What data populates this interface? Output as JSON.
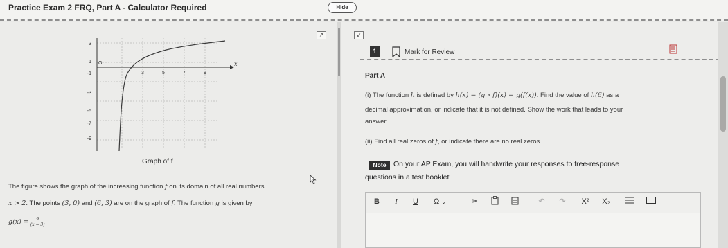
{
  "header": {
    "title": "Practice Exam 2 FRQ, Part A - Calculator Required",
    "hide_label": "Hide"
  },
  "graph": {
    "caption": "Graph of f",
    "y_ticks": [
      "3",
      "1",
      "-1",
      "-3",
      "-5",
      "-7",
      "-9"
    ],
    "x_ticks": [
      "3",
      "5",
      "7",
      "9"
    ],
    "origin_label": "O",
    "x_axis_label": "x"
  },
  "stimulus": {
    "line1": "The figure shows the graph of the increasing function",
    "line1_f": "f",
    "line1_end": "on its domain of all real numbers",
    "line2_x": "x > 2",
    "line2_a": ". The points",
    "point1": "(3, 0)",
    "line2_and": "and",
    "point2": "(6, 3)",
    "line2_b": "are on the graph of",
    "line2_f": "f",
    "line2_c": ". The function",
    "line2_g": "g",
    "line2_d": "is given by",
    "g_def": "g(x) = ",
    "g_num": "9",
    "g_den": "(x − 3)"
  },
  "question": {
    "number": "1",
    "mark_review": "Mark for Review",
    "part": "Part A",
    "i_a": "(i) The function",
    "i_h": "h",
    "i_b": "is defined by",
    "i_def": "h(x) = (g ∘ f)(x) = g(f(x))",
    "i_c": ". Find the value of",
    "i_h6": "h(6)",
    "i_d": "as a",
    "i_line2": "decimal approximation, or indicate that it is not defined. Show the work that leads to your",
    "i_line3": "answer.",
    "ii_a": "(ii) Find all real zeros of",
    "ii_f": "f",
    "ii_b": ", or indicate there are no real zeros.",
    "note_badge": "Note",
    "note_line1": "On your AP Exam, you will handwrite your responses to free-response",
    "note_line2": "questions in a test booklet"
  },
  "toolbar": {
    "bold": "B",
    "italic": "I",
    "underline": "U",
    "omega": "Ω",
    "superscript": "X²",
    "subscript": "X₂"
  },
  "colors": {
    "note_badge": "#2f2f2f",
    "question_number": "#333333",
    "graph_curve": "#3a3a3a",
    "grid": "#9a9a9a"
  },
  "icons": {
    "expand_left": "expand-arrows-icon",
    "expand_right": "collapse-arrows-icon",
    "bookmark": "bookmark-icon",
    "abc": "abc-icon",
    "cut": "scissors-icon",
    "paste": "clipboard-icon",
    "undo": "undo-icon",
    "redo": "redo-icon",
    "insert": "insert-list-icon",
    "wordcount": "word-count-icon"
  }
}
